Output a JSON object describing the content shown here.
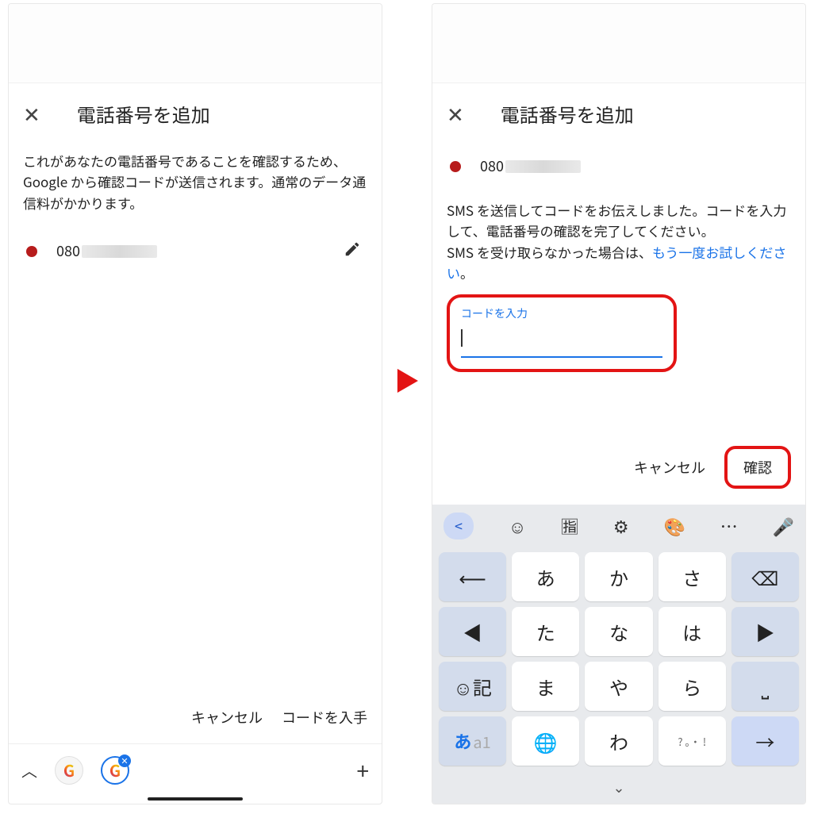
{
  "leftScreen": {
    "title": "電話番号を追加",
    "paragraph": "これがあなたの電話番号であることを確認するため、Google から確認コードが送信されます。通常のデータ通信料がかかります。",
    "phonePrefix": "080",
    "cancel": "キャンセル",
    "getCode": "コードを入手"
  },
  "rightScreen": {
    "title": "電話番号を追加",
    "phonePrefix": "080",
    "paragraphA": "SMS を送信してコードをお伝えしました。コードを入力して、電話番号の確認を完了してください。",
    "paragraphB_pre": "SMS を受け取らなかった場合は、",
    "paragraphB_link": "もう一度お試しください",
    "paragraphB_post": "。",
    "inputLabel": "コードを入力",
    "cancel": "キャンセル",
    "confirm": "確認"
  },
  "keyboard": {
    "rows": [
      [
        "←",
        "あ",
        "か",
        "さ",
        "⌫"
      ],
      [
        "◀",
        "た",
        "な",
        "は",
        "▶"
      ],
      [
        "☺記",
        "ま",
        "や",
        "ら",
        "⌴"
      ],
      [
        "mode",
        "⊕",
        "わ",
        "punct",
        "→"
      ]
    ],
    "punctHint": "?  。・ !"
  }
}
